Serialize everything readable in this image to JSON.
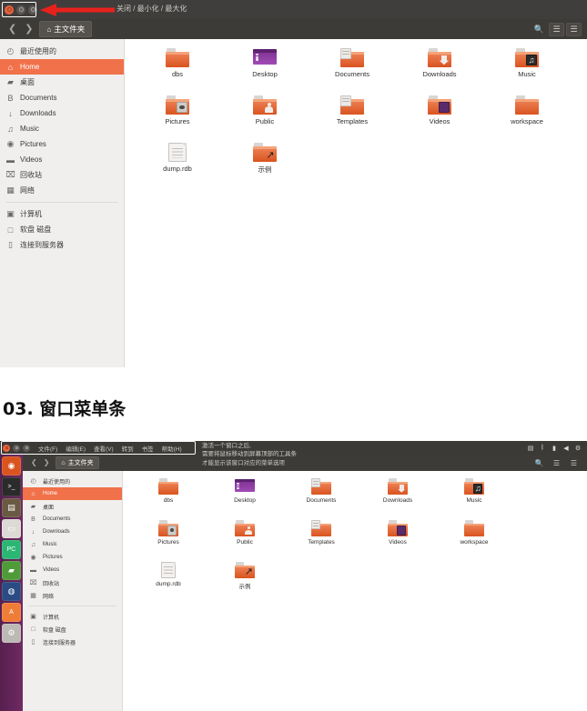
{
  "section": {
    "number": "03.",
    "title": "窗口菜单条",
    "full": "03. 窗口菜单条"
  },
  "window_one": {
    "annotation": "关闭 / 最小化 / 最大化",
    "titlebar": {
      "buttons": [
        {
          "name": "close",
          "color": "#e8643c"
        },
        {
          "name": "minimize",
          "color": "#5c5956"
        },
        {
          "name": "maximize",
          "color": "#5c5956"
        }
      ]
    },
    "headerbar": {
      "back_icon": "chevron-left-icon",
      "forward_icon": "chevron-right-icon",
      "path_label": "主文件夹",
      "home_icon": "home-icon",
      "search_icon": "search-icon",
      "list_view_icon": "list-view-icon",
      "menu_icon": "hamburger-menu-icon"
    },
    "sidebar": {
      "groups": [
        {
          "items": [
            {
              "label": "最近使用的",
              "icon": "clock-icon",
              "active": false
            },
            {
              "label": "Home",
              "icon": "home-icon",
              "active": true
            },
            {
              "label": "桌面",
              "icon": "desktop-folder-icon",
              "active": false
            },
            {
              "label": "Documents",
              "icon": "document-icon",
              "active": false
            },
            {
              "label": "Downloads",
              "icon": "download-arrow-icon",
              "active": false
            },
            {
              "label": "Music",
              "icon": "music-note-icon",
              "active": false
            },
            {
              "label": "Pictures",
              "icon": "camera-icon",
              "active": false
            },
            {
              "label": "Videos",
              "icon": "video-camera-icon",
              "active": false
            },
            {
              "label": "回收站",
              "icon": "trash-icon",
              "active": false
            },
            {
              "label": "网络",
              "icon": "network-icon",
              "active": false
            }
          ]
        },
        {
          "items": [
            {
              "label": "计算机",
              "icon": "computer-icon",
              "active": false
            },
            {
              "label": "软盘 磁盘",
              "icon": "floppy-disk-icon",
              "active": false
            },
            {
              "label": "连接到服务器",
              "icon": "server-connect-icon",
              "active": false
            }
          ]
        }
      ]
    },
    "files": [
      {
        "name": "dbs",
        "type": "folder",
        "badge": "none"
      },
      {
        "name": "Desktop",
        "type": "monitor",
        "badge": "none"
      },
      {
        "name": "Documents",
        "type": "folder",
        "badge": "doc"
      },
      {
        "name": "Downloads",
        "type": "folder",
        "badge": "dl"
      },
      {
        "name": "Music",
        "type": "folder",
        "badge": "music"
      },
      {
        "name": "Pictures",
        "type": "folder",
        "badge": "cam"
      },
      {
        "name": "Public",
        "type": "folder",
        "badge": "person"
      },
      {
        "name": "Templates",
        "type": "folder",
        "badge": "doc"
      },
      {
        "name": "Videos",
        "type": "folder",
        "badge": "purple"
      },
      {
        "name": "workspace",
        "type": "folder",
        "badge": "none"
      },
      {
        "name": "dump.rdb",
        "type": "file",
        "badge": "none"
      },
      {
        "name": "示例",
        "type": "folder",
        "badge": "link"
      }
    ]
  },
  "window_two": {
    "annotation": "激活一个窗口之后,\n需要将鼠标移动到屏幕顶部的工具条\n才能显示该窗口对应的菜单选项",
    "panel": {
      "menus": [
        {
          "label": "文件(F)"
        },
        {
          "label": "编辑(E)"
        },
        {
          "label": "查看(V)"
        },
        {
          "label": "转到"
        },
        {
          "label": "书签"
        },
        {
          "label": "帮助(H)"
        }
      ],
      "tray": [
        {
          "icon": "network-icon",
          "glyph": "▤"
        },
        {
          "icon": "bluetooth-icon",
          "glyph": "ᛒ"
        },
        {
          "icon": "battery-icon",
          "glyph": "▮"
        },
        {
          "icon": "volume-icon",
          "glyph": "◀"
        },
        {
          "icon": "power-gear-icon",
          "glyph": "⚙"
        }
      ]
    },
    "launcher": [
      {
        "name": "ubuntu-dash-icon",
        "glyph": "◉",
        "bg": "#d9541f"
      },
      {
        "name": "terminal-icon",
        "glyph": ">_",
        "bg": "#2b2b2b"
      },
      {
        "name": "files-manager-icon",
        "glyph": "▤",
        "bg": "#6b5a43"
      },
      {
        "name": "nautilus-folder-icon",
        "glyph": "▭",
        "bg": "#ddd9d4"
      },
      {
        "name": "pycharm-icon",
        "glyph": "PC",
        "bg": "#2cb673"
      },
      {
        "name": "dictionary-icon",
        "glyph": "▰",
        "bg": "#4f9b3a"
      },
      {
        "name": "firefox-icon",
        "glyph": "◍",
        "bg": "#2a4c82"
      },
      {
        "name": "android-studio-icon",
        "glyph": "A",
        "bg": "#ef7d38"
      },
      {
        "name": "settings-icon",
        "glyph": "⚙",
        "bg": "#bdb9b5"
      }
    ],
    "headerbar": {
      "back_icon": "chevron-left-icon",
      "forward_icon": "chevron-right-icon",
      "path_label": "主文件夹",
      "home_icon": "home-icon",
      "search_icon": "search-icon",
      "list_view_icon": "list-view-icon",
      "menu_icon": "hamburger-menu-icon"
    },
    "sidebar": {
      "groups": [
        {
          "items": [
            {
              "label": "最近使用的",
              "icon": "clock-icon",
              "active": false
            },
            {
              "label": "Home",
              "icon": "home-icon",
              "active": true
            },
            {
              "label": "桌面",
              "icon": "desktop-folder-icon",
              "active": false
            },
            {
              "label": "Documents",
              "icon": "document-icon",
              "active": false
            },
            {
              "label": "Downloads",
              "icon": "download-arrow-icon",
              "active": false
            },
            {
              "label": "Music",
              "icon": "music-note-icon",
              "active": false
            },
            {
              "label": "Pictures",
              "icon": "camera-icon",
              "active": false
            },
            {
              "label": "Videos",
              "icon": "video-camera-icon",
              "active": false
            },
            {
              "label": "回收站",
              "icon": "trash-icon",
              "active": false
            },
            {
              "label": "网络",
              "icon": "network-icon",
              "active": false
            }
          ]
        },
        {
          "items": [
            {
              "label": "计算机",
              "icon": "computer-icon",
              "active": false
            },
            {
              "label": "软盘 磁盘",
              "icon": "floppy-disk-icon",
              "active": false
            },
            {
              "label": "连接到服务器",
              "icon": "server-connect-icon",
              "active": false
            }
          ]
        }
      ]
    },
    "files": [
      {
        "name": "dbs",
        "type": "folder",
        "badge": "none"
      },
      {
        "name": "Desktop",
        "type": "monitor",
        "badge": "none"
      },
      {
        "name": "Documents",
        "type": "folder",
        "badge": "doc"
      },
      {
        "name": "Downloads",
        "type": "folder",
        "badge": "dl"
      },
      {
        "name": "Music",
        "type": "folder",
        "badge": "music"
      },
      {
        "name": "Pictures",
        "type": "folder",
        "badge": "cam"
      },
      {
        "name": "Public",
        "type": "folder",
        "badge": "person"
      },
      {
        "name": "Templates",
        "type": "folder",
        "badge": "doc"
      },
      {
        "name": "Videos",
        "type": "folder",
        "badge": "purple"
      },
      {
        "name": "workspace",
        "type": "folder",
        "badge": "none"
      },
      {
        "name": "dump.rdb",
        "type": "file",
        "badge": "none"
      },
      {
        "name": "示例",
        "type": "folder",
        "badge": "link"
      }
    ]
  },
  "colors": {
    "accent_orange": "#f0714a",
    "folder_orange": "#d9541f",
    "titlebar_dark": "#403e3c",
    "sidebar_bg": "#f1efed",
    "arrow_red": "#e8211c",
    "launcher_purple": "#702a63"
  }
}
